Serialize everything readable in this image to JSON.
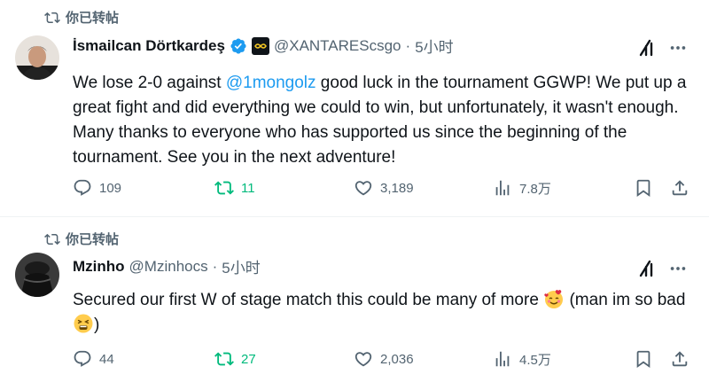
{
  "tweets": [
    {
      "retweet_label": "你已转帖",
      "author_name": "İsmailcan Dörtkardeş",
      "handle": "@XANTAREScsgo",
      "separator": "·",
      "time": "5小时",
      "text_before": "We lose 2-0 against ",
      "mention": "@1mongolz",
      "text_after": " good luck in the tournament GGWP! We put up a great fight and did everything we could to win, but unfortunately, it wasn't enough. Many thanks to everyone who has supported us since the beginning of the tournament. See you in the next adventure!",
      "replies": "109",
      "retweets": "11",
      "likes": "3,189",
      "views": "7.8万"
    },
    {
      "retweet_label": "你已转帖",
      "author_name": "Mzinho",
      "handle": "@Mzinhocs",
      "separator": "·",
      "time": "5小时",
      "text_main": "Secured our first W of stage match this could be many of more ",
      "text_paren_open": " (man im so bad ",
      "text_paren_close": ")",
      "replies": "44",
      "retweets": "27",
      "likes": "2,036",
      "views": "4.5万"
    }
  ],
  "icons": [
    "retweet-icon",
    "verified-badge-icon",
    "affiliate-badge-icon",
    "grok-icon",
    "more-icon",
    "reply-icon",
    "like-icon",
    "views-icon",
    "bookmark-icon",
    "share-icon",
    "smiling-hearts-emoji",
    "tired-face-emoji"
  ],
  "colors": {
    "accent": "#1d9bf0",
    "retweet_active": "#00ba7c",
    "secondary_text": "#536471",
    "primary_text": "#0f1419"
  }
}
